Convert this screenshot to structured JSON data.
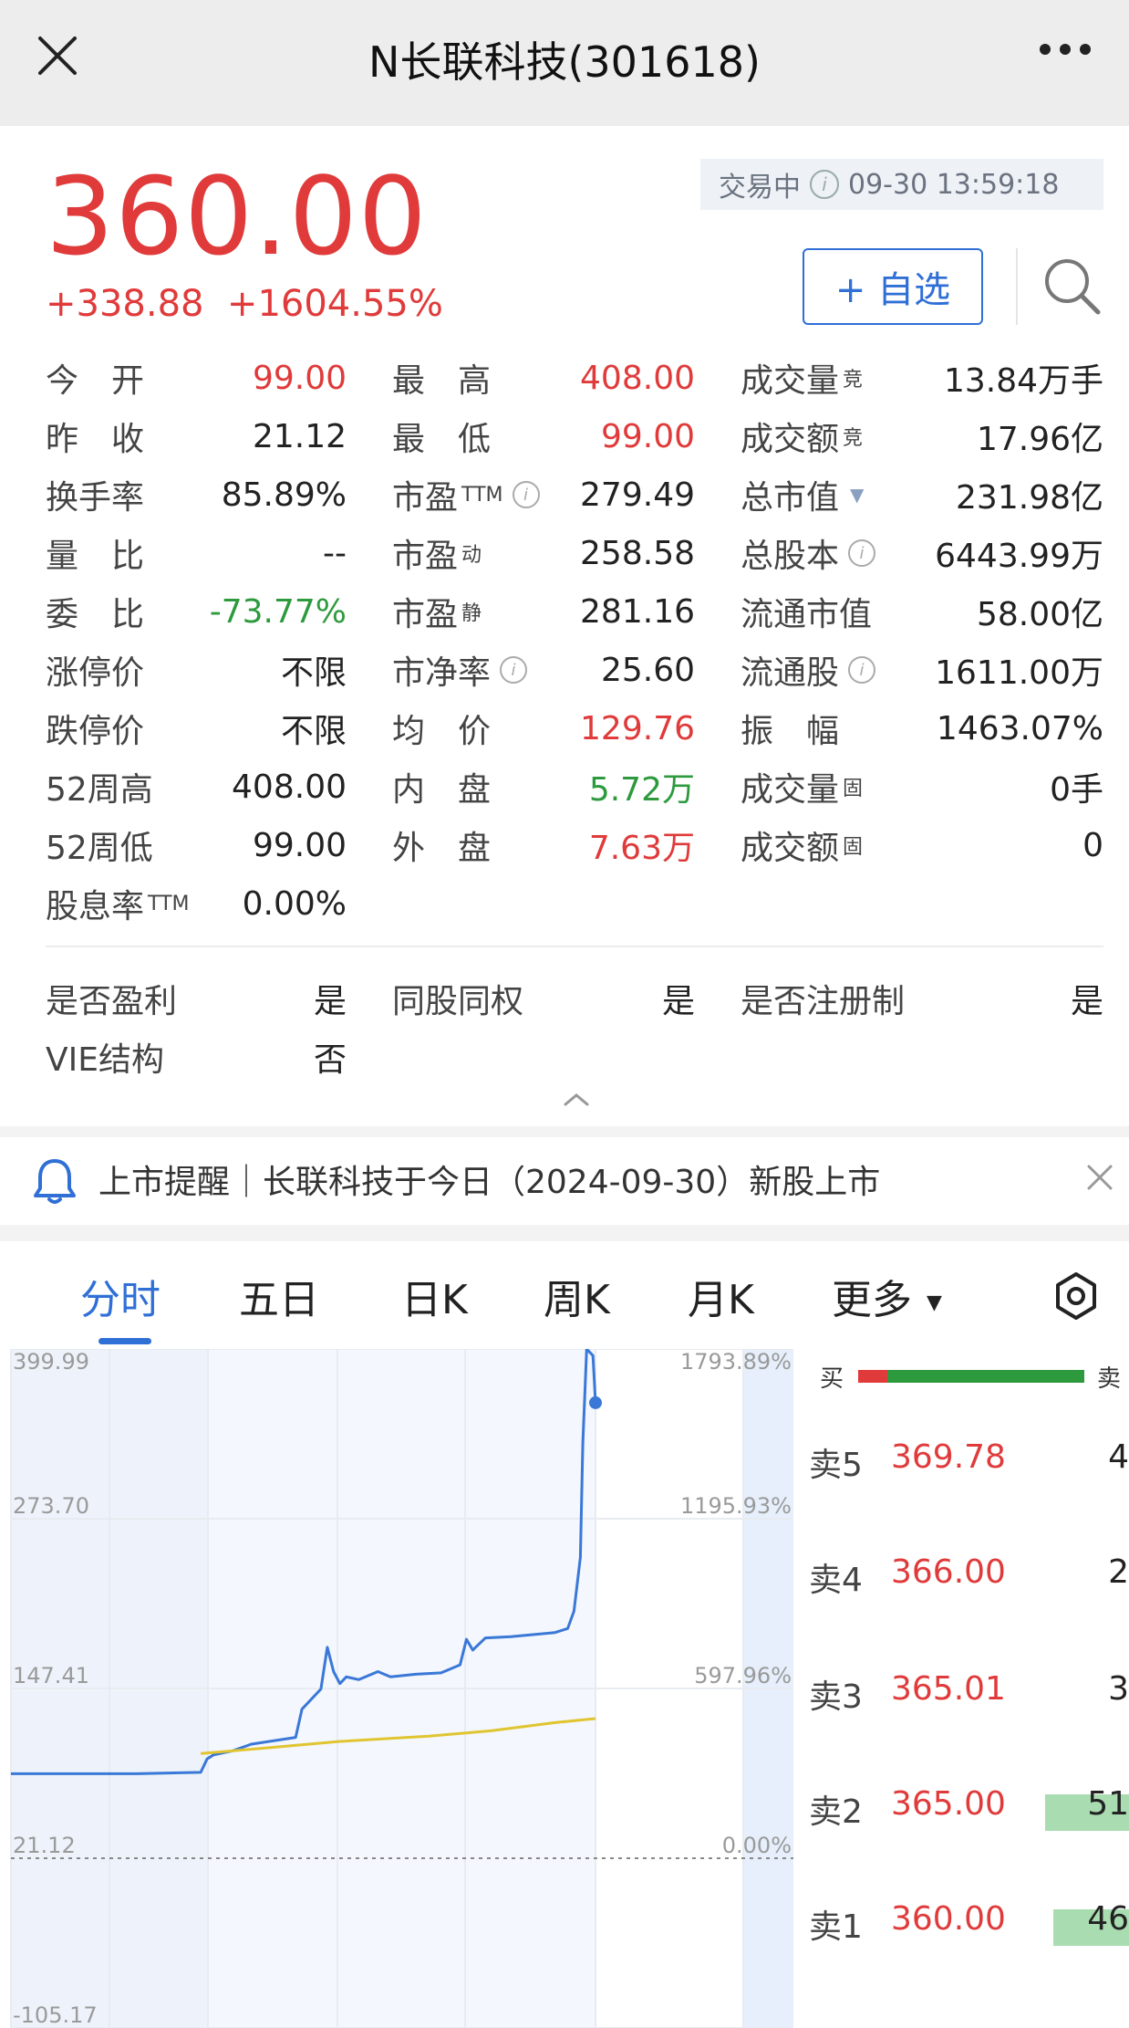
{
  "header": {
    "title": "N长联科技(301618)"
  },
  "quote": {
    "price": "360.00",
    "change": "+338.88",
    "change_pct": "+1604.55%",
    "status": "交易中",
    "datetime": "09-30 13:59:18",
    "watch_label": "+ 自选"
  },
  "stats": [
    [
      {
        "label": "今　开",
        "value": "99.00",
        "color": "red"
      },
      {
        "label": "最　高",
        "value": "408.00",
        "color": "red"
      },
      {
        "label": "成交量",
        "sup": "竞",
        "value": "13.84万手"
      }
    ],
    [
      {
        "label": "昨　收",
        "value": "21.12"
      },
      {
        "label": "最　低",
        "value": "99.00",
        "color": "red"
      },
      {
        "label": "成交额",
        "sup": "竞",
        "value": "17.96亿"
      }
    ],
    [
      {
        "label": "换手率",
        "value": "85.89%"
      },
      {
        "label": "市盈",
        "sup": "TTM",
        "info": true,
        "value": "279.49"
      },
      {
        "label": "总市值",
        "dropdown": true,
        "value": "231.98亿"
      }
    ],
    [
      {
        "label": "量　比",
        "value": "--"
      },
      {
        "label": "市盈",
        "sup": "动",
        "value": "258.58"
      },
      {
        "label": "总股本",
        "info": true,
        "value": "6443.99万"
      }
    ],
    [
      {
        "label": "委　比",
        "value": "-73.77%",
        "color": "green"
      },
      {
        "label": "市盈",
        "sup": "静",
        "value": "281.16"
      },
      {
        "label": "流通市值",
        "value": "58.00亿"
      }
    ],
    [
      {
        "label": "涨停价",
        "value": "不限"
      },
      {
        "label": "市净率",
        "info": true,
        "value": "25.60"
      },
      {
        "label": "流通股",
        "info": true,
        "value": "1611.00万"
      }
    ],
    [
      {
        "label": "跌停价",
        "value": "不限"
      },
      {
        "label": "均　价",
        "value": "129.76",
        "color": "red"
      },
      {
        "label": "振　幅",
        "value": "1463.07%"
      }
    ],
    [
      {
        "label": "52周高",
        "value": "408.00"
      },
      {
        "label": "内　盘",
        "value": "5.72万",
        "color": "green"
      },
      {
        "label": "成交量",
        "sup": "固",
        "value": "0手"
      }
    ],
    [
      {
        "label": "52周低",
        "value": "99.00"
      },
      {
        "label": "外　盘",
        "value": "7.63万",
        "color": "red"
      },
      {
        "label": "成交额",
        "sup": "固",
        "value": "0"
      }
    ],
    [
      {
        "label": "股息率",
        "sup": "TTM",
        "value": "0.00%"
      }
    ]
  ],
  "stats2": [
    [
      {
        "label": "是否盈利",
        "value": "是"
      },
      {
        "label": "同股同权",
        "value": "是"
      },
      {
        "label": "是否注册制",
        "value": "是"
      }
    ],
    [
      {
        "label": "VIE结构",
        "value": "否"
      }
    ]
  ],
  "notice": {
    "text": "上市提醒｜长联科技于今日（2024-09-30）新股上市"
  },
  "tabs": [
    "分时",
    "五日",
    "日K",
    "周K",
    "月K",
    "更多"
  ],
  "active_tab": "分时",
  "chart_data": {
    "type": "line",
    "y_left_ticks": [
      "399.99",
      "273.70",
      "147.41",
      "21.12",
      "-105.17"
    ],
    "y_right_ticks": [
      "1793.89%",
      "1195.93%",
      "597.96%",
      "0.00%"
    ],
    "ylim": [
      -105.17,
      399.99
    ],
    "prev_close": 21.12,
    "series": [
      {
        "color": "#3a78d8",
        "values": [
          [
            0,
            84
          ],
          [
            100,
            84
          ],
          [
            150,
            85
          ],
          [
            155,
            95
          ],
          [
            160,
            98
          ],
          [
            175,
            101
          ],
          [
            190,
            106
          ],
          [
            225,
            111
          ],
          [
            230,
            132
          ],
          [
            245,
            147
          ],
          [
            250,
            178
          ],
          [
            255,
            160
          ],
          [
            260,
            151
          ],
          [
            265,
            156
          ],
          [
            275,
            154
          ],
          [
            290,
            160
          ],
          [
            300,
            156
          ],
          [
            320,
            158
          ],
          [
            340,
            159
          ],
          [
            355,
            165
          ],
          [
            360,
            184
          ],
          [
            365,
            176
          ],
          [
            375,
            185
          ],
          [
            395,
            186
          ],
          [
            430,
            189
          ],
          [
            440,
            192
          ],
          [
            445,
            205
          ],
          [
            450,
            245
          ],
          [
            452,
            330
          ],
          [
            455,
            400
          ],
          [
            460,
            395
          ],
          [
            462,
            360
          ]
        ]
      },
      {
        "color": "#e0c531",
        "values": [
          [
            150,
            99
          ],
          [
            200,
            103
          ],
          [
            260,
            108
          ],
          [
            330,
            112
          ],
          [
            380,
            116
          ],
          [
            430,
            122
          ],
          [
            462,
            125
          ]
        ]
      }
    ],
    "last_point": [
      462,
      360
    ]
  },
  "order_book": {
    "head_left": "买",
    "head_right": "卖",
    "rows": [
      {
        "label": "卖5",
        "price": "369.78",
        "qty": "4",
        "bar": 0
      },
      {
        "label": "卖4",
        "price": "366.00",
        "qty": "2",
        "bar": 0
      },
      {
        "label": "卖3",
        "price": "365.01",
        "qty": "3",
        "bar": 0
      },
      {
        "label": "卖2",
        "price": "365.00",
        "qty": "51",
        "bar": 0.77
      },
      {
        "label": "卖1",
        "price": "360.00",
        "qty": "46",
        "bar": 0.69
      }
    ]
  },
  "colors": {
    "up": "#e03a3a",
    "down": "#2d9a3e",
    "accent": "#2f6fd6"
  }
}
